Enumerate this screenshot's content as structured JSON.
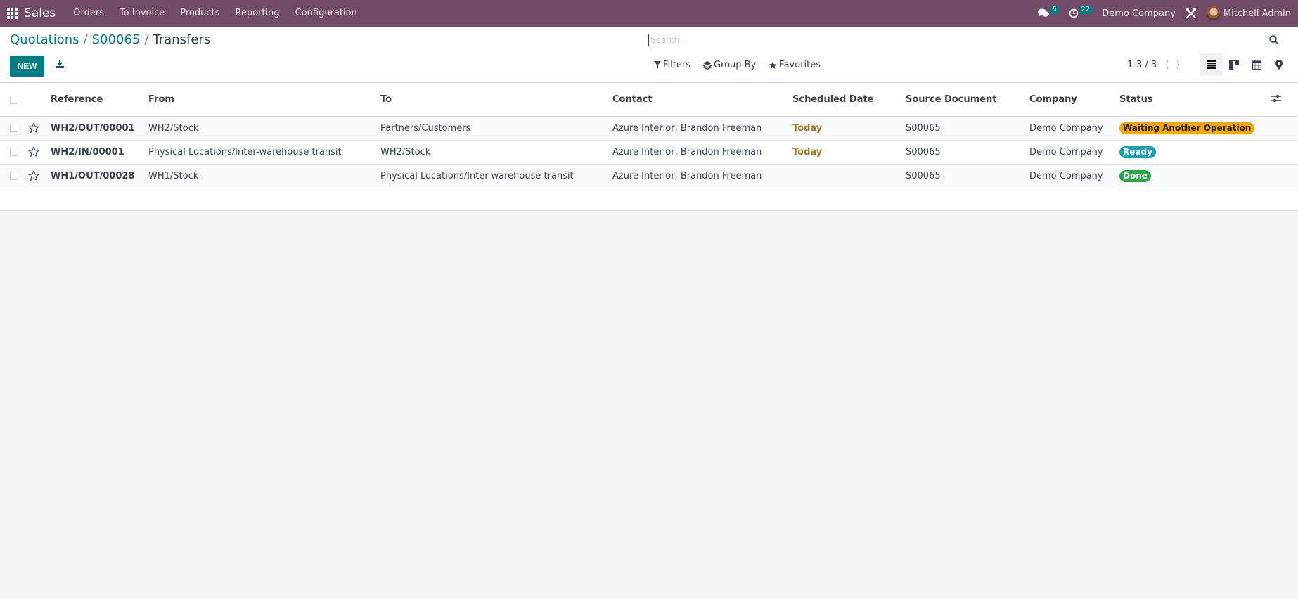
{
  "navbar": {
    "app_name": "Sales",
    "menu": [
      "Orders",
      "To Invoice",
      "Products",
      "Reporting",
      "Configuration"
    ],
    "messages_count": "6",
    "activities_count": "22",
    "company": "Demo Company",
    "user": "Mitchell Admin"
  },
  "breadcrumb": {
    "items": [
      "Quotations",
      "S00065"
    ],
    "current": "Transfers",
    "separator": "/"
  },
  "toolbar": {
    "new_label": "NEW"
  },
  "search": {
    "placeholder": "Search...",
    "value": ""
  },
  "filters": {
    "filters_label": "Filters",
    "group_by_label": "Group By",
    "favorites_label": "Favorites"
  },
  "pager": {
    "value": "1-3 / 3"
  },
  "views": [
    "list",
    "kanban",
    "calendar",
    "map"
  ],
  "active_view": "list",
  "table": {
    "columns": [
      "Reference",
      "From",
      "To",
      "Contact",
      "Scheduled Date",
      "Source Document",
      "Company",
      "Status"
    ],
    "rows": [
      {
        "reference": "WH2/OUT/00001",
        "from": "WH2/Stock",
        "to": "Partners/Customers",
        "contact": "Azure Interior, Brandon Freeman",
        "scheduled_date": "Today",
        "source_document": "S00065",
        "company": "Demo Company",
        "status": "Waiting Another Operation"
      },
      {
        "reference": "WH2/IN/00001",
        "from": "Physical Locations/Inter-warehouse transit",
        "to": "WH2/Stock",
        "contact": "Azure Interior, Brandon Freeman",
        "scheduled_date": "Today",
        "source_document": "S00065",
        "company": "Demo Company",
        "status": "Ready"
      },
      {
        "reference": "WH1/OUT/00028",
        "from": "WH1/Stock",
        "to": "Physical Locations/Inter-warehouse transit",
        "contact": "Azure Interior, Brandon Freeman",
        "scheduled_date": "",
        "source_document": "S00065",
        "company": "Demo Company",
        "status": "Done"
      }
    ]
  },
  "colors": {
    "navbar": "#714b67",
    "primary": "#017e84",
    "today": "#a0761c",
    "status_waiting": "#f6a800",
    "status_ready": "#17a2b8",
    "status_done": "#28a745"
  }
}
